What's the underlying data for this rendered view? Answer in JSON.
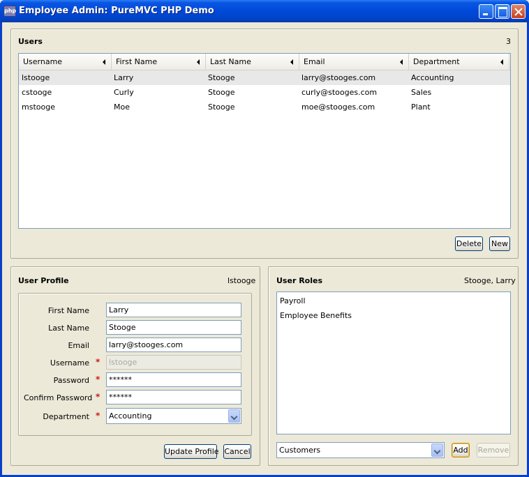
{
  "window": {
    "icon_text": "php",
    "title": "Employee Admin: PureMVC PHP Demo"
  },
  "users_panel": {
    "title": "Users",
    "count": "3",
    "columns": [
      "Username",
      "First Name",
      "Last Name",
      "Email",
      "Department"
    ],
    "rows": [
      {
        "username": "lstooge",
        "first": "Larry",
        "last": "Stooge",
        "email": "larry@stooges.com",
        "department": "Accounting"
      },
      {
        "username": "cstooge",
        "first": "Curly",
        "last": "Stooge",
        "email": "curly@stooges.com",
        "department": "Sales"
      },
      {
        "username": "mstooge",
        "first": "Moe",
        "last": "Stooge",
        "email": "moe@stooges.com",
        "department": "Plant"
      }
    ],
    "delete_label": "Delete",
    "new_label": "New"
  },
  "profile_panel": {
    "title": "User Profile",
    "username_meta": "lstooge",
    "fields": {
      "first_name": {
        "label": "First Name",
        "value": "Larry"
      },
      "last_name": {
        "label": "Last Name",
        "value": "Stooge"
      },
      "email": {
        "label": "Email",
        "value": "larry@stooges.com"
      },
      "username": {
        "label": "Username",
        "value": "lstooge"
      },
      "password": {
        "label": "Password",
        "value": "******"
      },
      "confirm": {
        "label": "Confirm Password",
        "value": "******"
      },
      "department": {
        "label": "Department",
        "value": "Accounting"
      }
    },
    "required_mark": "*",
    "update_label": "Update Profile",
    "cancel_label": "Cancel"
  },
  "roles_panel": {
    "title": "User Roles",
    "user_meta": "Stooge, Larry",
    "roles": [
      "Payroll",
      "Employee Benefits"
    ],
    "role_select": "Customers",
    "add_label": "Add",
    "remove_label": "Remove"
  }
}
